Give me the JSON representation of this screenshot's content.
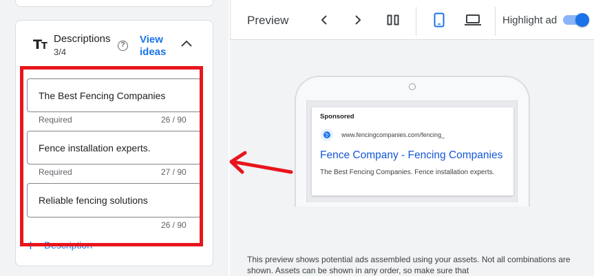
{
  "descriptions": {
    "title": "Descriptions",
    "count": "3/4",
    "view_ideas": "View ideas",
    "fields": [
      {
        "value": "The Best Fencing Companies",
        "helper": "Required",
        "counter": "26 / 90"
      },
      {
        "value": "Fence installation experts.",
        "helper": "Required",
        "counter": "27 / 90"
      },
      {
        "value": "Reliable fencing solutions",
        "helper": "",
        "counter": "26 / 90"
      }
    ],
    "add_label": "Description",
    "add_symbol": "+"
  },
  "preview": {
    "title": "Preview",
    "highlight_label": "Highlight ad",
    "highlight_on": true
  },
  "ad": {
    "sponsored": "Sponsored",
    "url": "www.fencingcompanies.com/fencing_",
    "headline": "Fence Company - Fencing Companies",
    "description": "The Best Fencing Companies. Fence installation experts."
  },
  "footer": {
    "text": "This preview shows potential ads assembled using your assets. Not all combinations are shown. Assets can be shown in any order, so make sure that"
  },
  "colors": {
    "accent": "#1a73e8",
    "annotation_red": "#e8151c"
  }
}
